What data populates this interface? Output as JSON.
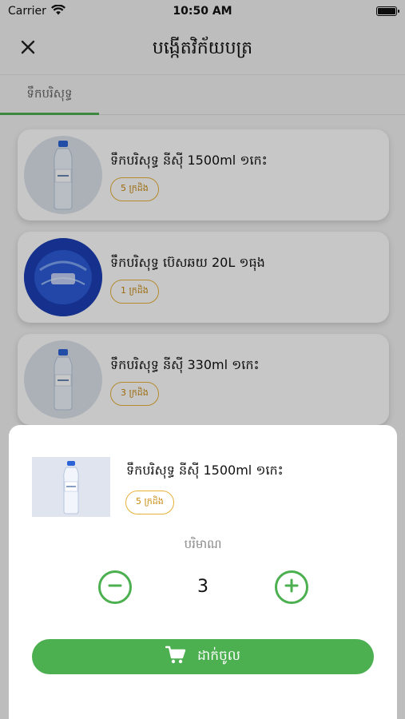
{
  "status_bar": {
    "carrier": "Carrier",
    "time": "10:50 AM"
  },
  "header": {
    "title": "បង្កើតវិក័យបត្រ",
    "close_icon": "close-icon"
  },
  "tabs": [
    {
      "label": "ទឹកបរិសុទ្ធ",
      "active": true
    }
  ],
  "products": [
    {
      "name": "ទឹកបរិសុទ្ធ នីស៊ី 1500ml ១កេះ",
      "stock": "5 ក្រដិង",
      "image": "small-bottle"
    },
    {
      "name": "ទឹកបរិសុទ្ធ ប៊េសឆយ 20L ១ធុង",
      "stock": "1 ក្រដិង",
      "image": "large-jug"
    },
    {
      "name": "ទឹកបរិសុទ្ធ នីស៊ី 330ml ១កេះ",
      "stock": "3 ក្រដិង",
      "image": "small-bottle"
    }
  ],
  "sheet": {
    "product_name": "ទឹកបរិសុទ្ធ នីស៊ី 1500ml ១កេះ",
    "stock": "5 ក្រដិង",
    "quantity_label": "បរិមាណ",
    "quantity": "3",
    "add_button_label": "ដាក់ចូល"
  },
  "colors": {
    "accent": "#4caf50",
    "badge": "#e8b13a"
  }
}
